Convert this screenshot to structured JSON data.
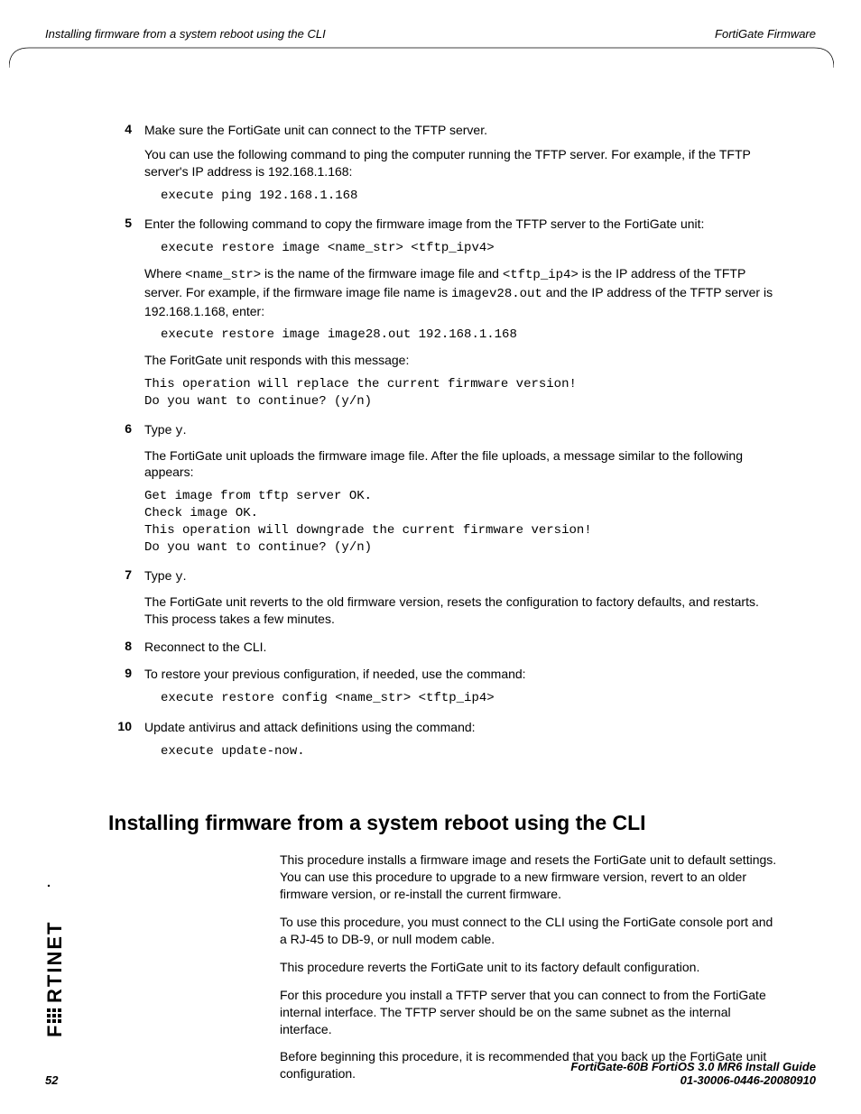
{
  "header": {
    "left": "Installing firmware from a system reboot using the CLI",
    "right": "FortiGate Firmware"
  },
  "steps": {
    "s4": {
      "num": "4",
      "line1": "Make sure the FortiGate unit can connect to the TFTP server.",
      "line2": "You can use the following command to ping the computer running the TFTP server. For example, if the TFTP server's IP address is 192.168.1.168:",
      "code1": "execute ping 192.168.1.168"
    },
    "s5": {
      "num": "5",
      "line1": "Enter the following command to copy the firmware image from the TFTP server to the FortiGate unit:",
      "code1": "execute restore image <name_str> <tftp_ipv4>",
      "where_a": "Where ",
      "where_b": "<name_str>",
      "where_c": " is the name of the firmware image file and ",
      "where_d": "<tftp_ip4>",
      "where_e": " is the IP address of the TFTP server. For example, if the firmware image file name is ",
      "where_f": "imagev28.out",
      "where_g": " and the IP address of the TFTP server is 192.168.1.168, enter:",
      "code2": "execute restore image image28.out 192.168.1.168",
      "line3": "The ForitGate unit responds with this message:",
      "code3a": "This operation will replace the current firmware version!",
      "code3b": "Do you want to continue? (y/n)"
    },
    "s6": {
      "num": "6",
      "type_a": "Type ",
      "type_b": "y",
      "type_c": ".",
      "line2": "The FortiGate unit uploads the firmware image file. After the file uploads, a message similar to the following appears:",
      "code_a": "Get image from tftp server OK.",
      "code_b": "Check image OK.",
      "code_c": "This operation will downgrade the current firmware version!",
      "code_d": "Do you want to continue? (y/n)"
    },
    "s7": {
      "num": "7",
      "type_a": "Type ",
      "type_b": "y",
      "type_c": ".",
      "line2": "The FortiGate unit reverts to the old firmware version, resets the configuration to factory defaults, and restarts. This process takes a few minutes."
    },
    "s8": {
      "num": "8",
      "line1": "Reconnect to the CLI."
    },
    "s9": {
      "num": "9",
      "line1": "To restore your previous configuration, if needed, use the command:",
      "code1": "execute restore config <name_str> <tftp_ip4>"
    },
    "s10": {
      "num": "10",
      "line1": "Update antivirus and attack definitions using the command:",
      "code1": "execute update-now."
    }
  },
  "section": {
    "heading": "Installing firmware from a system reboot using the CLI",
    "p1": "This procedure installs a firmware image and resets the FortiGate unit to default settings. You can use this procedure to upgrade to a new firmware version, revert to an older firmware version, or re-install the current firmware.",
    "p2": "To use this procedure, you must connect to the CLI using the FortiGate console port and a RJ-45 to DB-9, or null modem cable.",
    "p3": "This procedure reverts the FortiGate unit to its factory default configuration.",
    "p4": "For this procedure you install a TFTP server that you can connect to from the FortiGate internal interface. The TFTP server should be on the same subnet as the internal interface.",
    "p5": "Before beginning this procedure, it is recommended that you back up the FortiGate unit configuration."
  },
  "footer": {
    "page": "52",
    "guide": "FortiGate-60B FortiOS 3.0 MR6 Install Guide",
    "docid": "01-30006-0446-20080910"
  }
}
